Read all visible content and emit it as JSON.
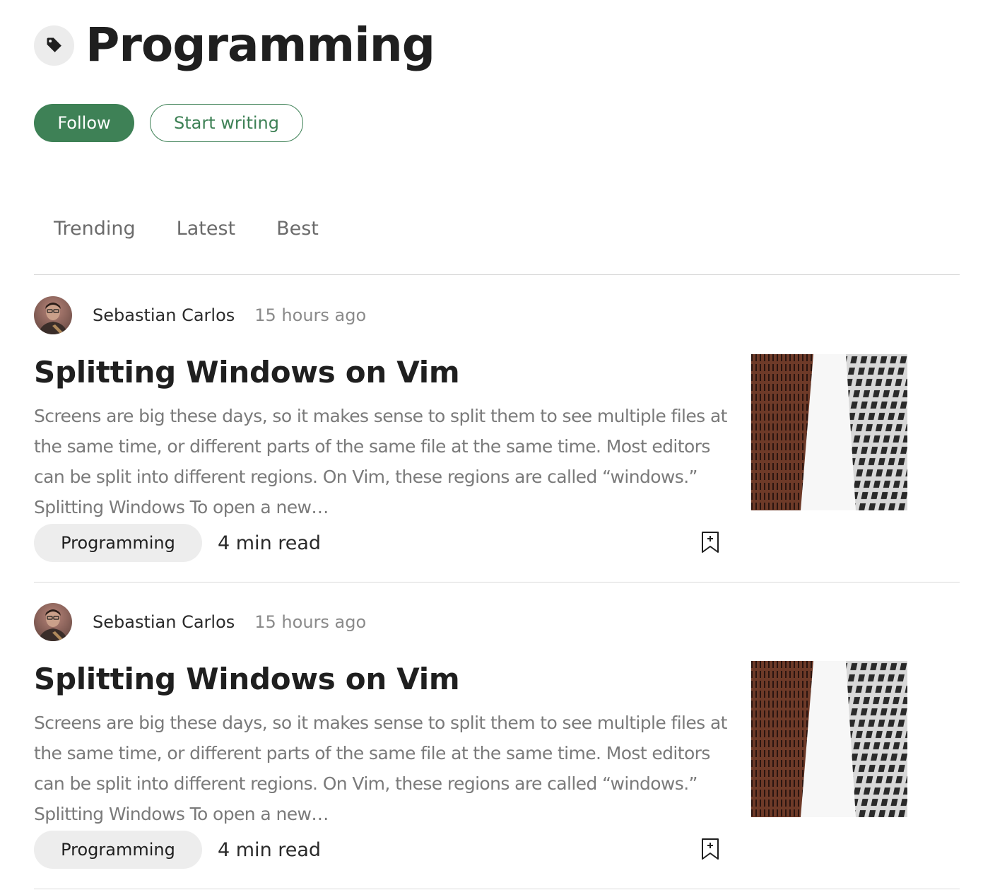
{
  "page": {
    "title": "Programming",
    "tag_icon": "tag-icon"
  },
  "actions": {
    "follow_label": "Follow",
    "write_label": "Start writing"
  },
  "colors": {
    "accent": "#3e8156",
    "chip_bg": "#ededed",
    "muted_text": "#7a7a7a"
  },
  "tabs": [
    {
      "label": "Trending"
    },
    {
      "label": "Latest"
    },
    {
      "label": "Best"
    }
  ],
  "articles": [
    {
      "author": "Sebastian Carlos",
      "time": "15 hours ago",
      "title": "Splitting Windows on Vim",
      "excerpt": "Screens are big these days, so it makes sense to split them to see multiple files at the same time, or different parts of the same file at the same time. Most editors can be split into different regions. On Vim, these regions are called “windows.” Splitting Windows To open a new…",
      "tag": "Programming",
      "read_time": "4 min read",
      "bookmark_icon": "bookmark-add-icon"
    },
    {
      "author": "Sebastian Carlos",
      "time": "15 hours ago",
      "title": "Splitting Windows on Vim",
      "excerpt": "Screens are big these days, so it makes sense to split them to see multiple files at the same time, or different parts of the same file at the same time. Most editors can be split into different regions. On Vim, these regions are called “windows.” Splitting Windows To open a new…",
      "tag": "Programming",
      "read_time": "4 min read",
      "bookmark_icon": "bookmark-add-icon"
    }
  ]
}
